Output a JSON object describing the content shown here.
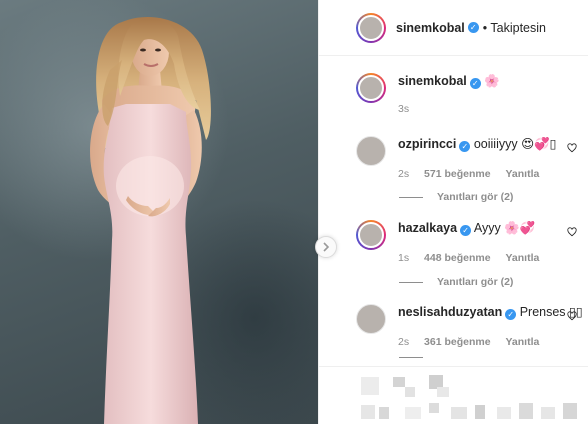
{
  "post": {
    "author": "sinemkobal",
    "follow_status": "• Takiptesin"
  },
  "caption": {
    "user": "sinemkobal",
    "emoji": "🌸",
    "time": "3s"
  },
  "comments": [
    {
      "user": "ozpirincci",
      "text": "ooiiiiyyy 😍💞▯",
      "time": "2s",
      "likes": "571 beğenme",
      "reply": "Yanıtla",
      "replies": "Yanıtları gör (2)"
    },
    {
      "user": "hazalkaya",
      "text": "Ayyy 🌸💞",
      "time": "1s",
      "likes": "448 beğenme",
      "reply": "Yanıtla",
      "replies": "Yanıtları gör (2)"
    },
    {
      "user": "neslisahduzyatan",
      "text": "Prenses ▯▯",
      "time": "2s",
      "likes": "361 beğenme",
      "reply": "Yanıtla"
    }
  ],
  "colors": {
    "verified": "#3897f0",
    "muted": "#8e8e8e",
    "border": "#efefef"
  },
  "icons": [
    "verified-badge-icon",
    "chevron-right-icon",
    "heart-icon"
  ]
}
